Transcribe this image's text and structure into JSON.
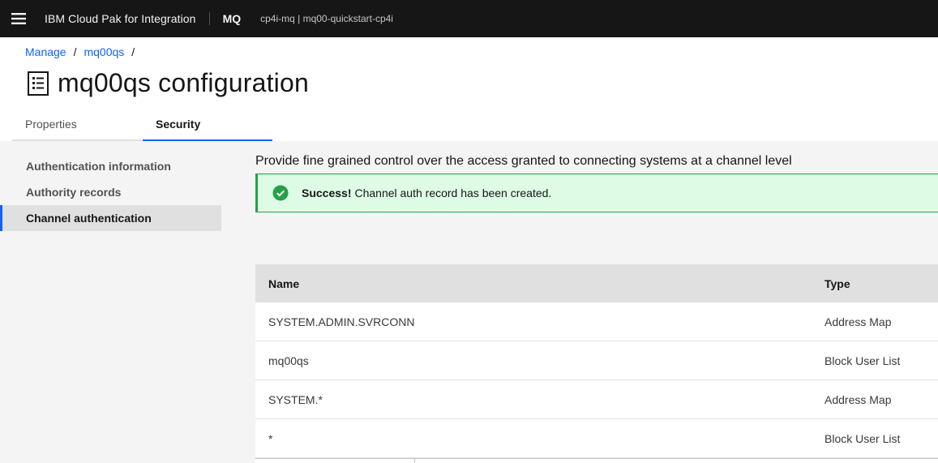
{
  "header": {
    "brand": "IBM Cloud Pak for Integration",
    "product": "MQ",
    "instance": "cp4i-mq | mq00-quickstart-cp4i",
    "menu_icon": "hamburger-menu-icon"
  },
  "breadcrumb": {
    "items": [
      "Manage",
      "mq00qs"
    ],
    "separator": "/"
  },
  "page": {
    "title": "mq00qs configuration",
    "title_icon": "document-list-icon"
  },
  "tabs": [
    {
      "label": "Properties",
      "active": false
    },
    {
      "label": "Security",
      "active": true
    }
  ],
  "sidenav": {
    "items": [
      {
        "label": "Authentication information",
        "selected": false
      },
      {
        "label": "Authority records",
        "selected": false
      },
      {
        "label": "Channel authentication",
        "selected": true
      }
    ]
  },
  "main": {
    "description": "Provide fine grained control over the access granted to connecting systems at a channel level",
    "notification": {
      "title": "Success!",
      "message": "Channel auth record has been created.",
      "icon": "checkmark-filled-icon"
    },
    "table": {
      "columns": [
        "Name",
        "Type"
      ],
      "rows": [
        {
          "name": "SYSTEM.ADMIN.SVRCONN",
          "type": "Address Map"
        },
        {
          "name": "mq00qs",
          "type": "Block User List"
        },
        {
          "name": "SYSTEM.*",
          "type": "Address Map"
        },
        {
          "name": "*",
          "type": "Block User List"
        }
      ]
    }
  },
  "colors": {
    "topbar": "#161616",
    "accent": "#0f62fe",
    "success": "#24a148",
    "success_bg": "#defbe6",
    "panel_bg": "#f4f4f4"
  }
}
